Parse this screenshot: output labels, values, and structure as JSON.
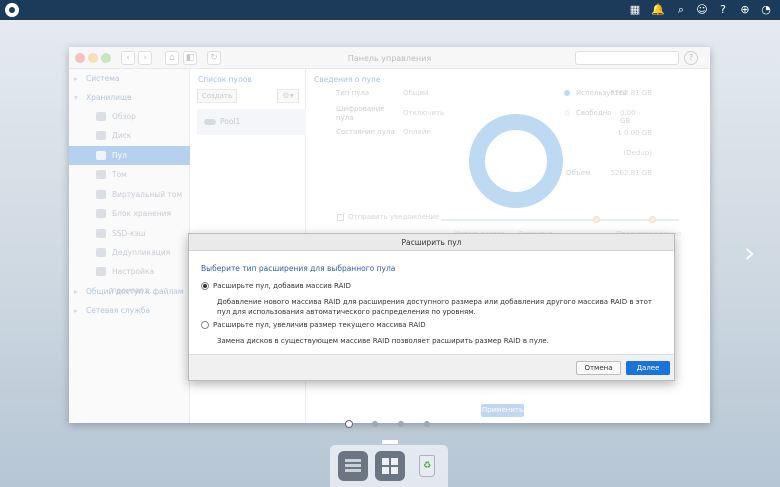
{
  "topbar": {
    "icons": [
      "apps-icon",
      "notification-bell-icon",
      "search-icon",
      "user-icon",
      "help-icon",
      "globe-icon",
      "dashboard-icon"
    ]
  },
  "window": {
    "title": "Панель управления",
    "help": "?",
    "sidebar": {
      "system": "Система",
      "storage": "Хранилище",
      "items": [
        "Обзор",
        "Диск",
        "Пул",
        "Том",
        "Виртуальный том",
        "Блок хранения",
        "SSD-кэш",
        "Дедупликация",
        "Настройка производ."
      ],
      "active": "Пул",
      "shared_access": "Общий доступ к файлам",
      "network": "Сетевая служба"
    },
    "pool_list": {
      "title": "Список пулов",
      "create": "Создать",
      "pool_name": "Pool1"
    },
    "pool_info": {
      "title": "Сведения о пуле",
      "type_label": "Тип пула",
      "type_value": "Общий",
      "encryption_label": "Шифрование пула",
      "encryption_value": "Отключить",
      "state_label": "Состояние пула",
      "state_value": "Онлайн",
      "usage_percent": "100%",
      "legend": [
        {
          "label": "Используется",
          "value": "5262.81 GB",
          "color": "#9cc6ed"
        },
        {
          "label": "Свободно",
          "value": "0.00 GB",
          "color": "#f0f0f0"
        },
        {
          "label": "",
          "value": "1 0.00 GB",
          "color": ""
        },
        {
          "label": "",
          "value": "(Dedup)",
          "color": ""
        },
        {
          "label": "Объем",
          "value": "5262.81 GB",
          "color": ""
        }
      ],
      "notify_label": "Отправить уведомление",
      "bottom_legend": [
        "Используется",
        "Доступно",
        "Предупреждение"
      ],
      "apply": "Применить"
    }
  },
  "modal": {
    "title": "Расширить пул",
    "heading": "Выберите тип расширения для выбранного пула",
    "option1": "Расширьте пул, добавив массив RAID",
    "option1_desc": "Добавление нового массива RAID для расширения доступного размера или добавления другого массива RAID в этот пул для использования автоматического распределения по уровням.",
    "option2": "Расширьте пул, увеличив размер текущего массива RAID",
    "option2_desc": "Замена дисков в существующем массиве RAID позволяет расширить размер RAID в пуле.",
    "cancel": "Отмена",
    "next": "Далее"
  }
}
